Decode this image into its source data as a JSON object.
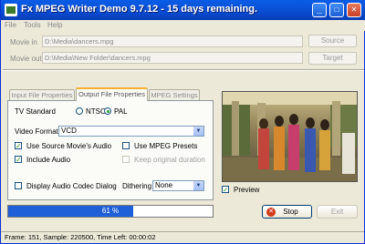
{
  "window": {
    "title": "Fx MPEG Writer Demo 9.7.12 - 15 days remaining.",
    "controls": {
      "minimize": "_",
      "maximize": "□",
      "close": "✕"
    }
  },
  "menu": [
    "File",
    "Tools",
    "Help"
  ],
  "files": {
    "movie_in_label": "Movie in",
    "movie_in_value": "D:\\Media\\dancers.mpg",
    "movie_out_label": "Movie out",
    "movie_out_value": "D:\\Media\\New Folder\\dancers.mpg",
    "source_button": "Source",
    "target_button": "Target"
  },
  "tabs": [
    {
      "label": "Input File Properties",
      "active": false
    },
    {
      "label": "Output File Properties",
      "active": true
    },
    {
      "label": "MPEG Settings",
      "active": false
    }
  ],
  "output": {
    "tv_standard_label": "TV Standard",
    "tv_options": [
      {
        "label": "NTSC",
        "selected": false
      },
      {
        "label": "PAL",
        "selected": true
      }
    ],
    "video_format_label": "Video Format",
    "video_format_value": "VCD",
    "use_source_audio": {
      "label": "Use Source Movie's Audio",
      "checked": true
    },
    "use_mpeg_presets": {
      "label": "Use MPEG Presets",
      "checked": false
    },
    "include_audio": {
      "label": "Include Audio",
      "checked": true
    },
    "keep_original_duration": {
      "label": "Keep original duration",
      "checked": false,
      "disabled": true
    },
    "display_audio_codec": {
      "label": "Display Audio  Codec Dialog",
      "checked": false
    },
    "dithering_label": "Dithering",
    "dithering_value": "None"
  },
  "preview": {
    "label": "Preview",
    "checked": true
  },
  "progress": {
    "percent": 61,
    "text": "61 %"
  },
  "actions": {
    "stop": "Stop",
    "exit": "Exit"
  },
  "status": "Frame:  151, Sample:  220500, Time Left: 00:00:02",
  "colors": {
    "title_bar": "#0a5ce6",
    "progress": "#1f5fd8",
    "active_tab_accent": "#f5b033",
    "check": "#21a121"
  },
  "icons": [
    "app-icon",
    "stop-icon",
    "combo-arrow-icon"
  ]
}
